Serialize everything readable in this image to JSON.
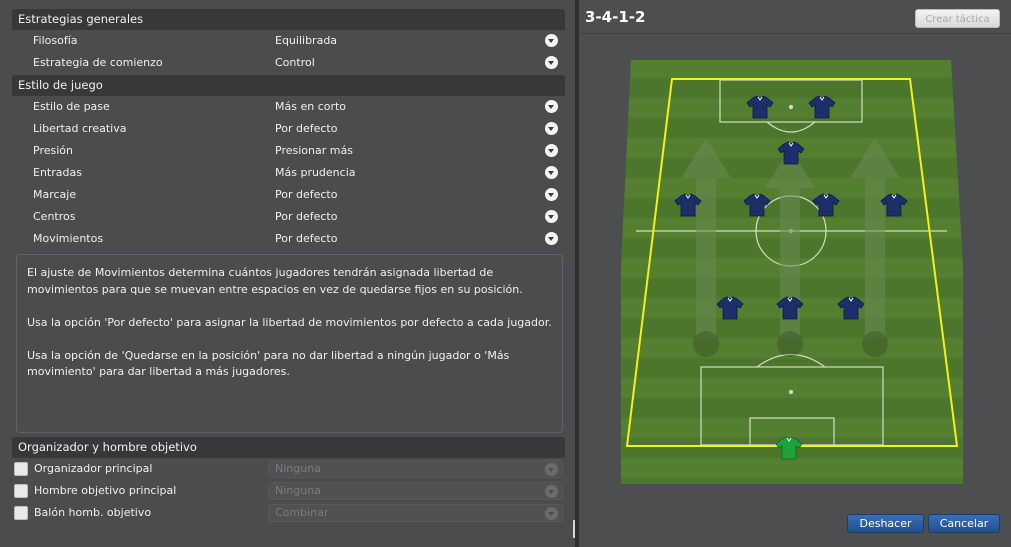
{
  "strategy": {
    "header": "Estrategias generales",
    "rows": [
      {
        "label": "Filosofía",
        "value": "Equilibrada"
      },
      {
        "label": "Estrategia de comienzo",
        "value": "Control"
      }
    ]
  },
  "style": {
    "header": "Estilo de juego",
    "rows": [
      {
        "label": "Estilo de pase",
        "value": "Más en corto"
      },
      {
        "label": "Libertad creativa",
        "value": "Por defecto"
      },
      {
        "label": "Presión",
        "value": "Presionar más"
      },
      {
        "label": "Entradas",
        "value": "Más prudencia"
      },
      {
        "label": "Marcaje",
        "value": "Por defecto"
      },
      {
        "label": "Centros",
        "value": "Por defecto"
      },
      {
        "label": "Movimientos",
        "value": "Por defecto"
      }
    ]
  },
  "info": {
    "p1": "El ajuste de Movimientos determina cuántos jugadores tendrán asignada libertad de\nmovimientos para que se muevan entre espacios en vez de quedarse fijos en su posición.",
    "p2": "Usa la opción 'Por defecto' para asignar la libertad de movimientos por defecto a cada jugador.",
    "p3": "Usa la opción de 'Quedarse en la posición' para no dar libertad a ningún jugador o 'Más\nmovimiento' para dar libertad a más jugadores."
  },
  "organizer": {
    "header": "Organizador y hombre objetivo",
    "rows": [
      {
        "label": "Organizador principal",
        "value": "Ninguna"
      },
      {
        "label": "Hombre objetivo principal",
        "value": "Ninguna"
      },
      {
        "label": "Balón homb. objetivo",
        "value": "Combinar"
      }
    ]
  },
  "tactic": {
    "formation": "3-4-1-2",
    "create_space": "Crear táctica",
    "undo": "Deshacer",
    "cancel": "Cancelar"
  },
  "colors": {
    "pitch_green": "#4f7a2c",
    "outline_yellow": "#f5f019",
    "shirt_blue": "#1c2f6b",
    "keeper_green": "#1fa23c",
    "button_blue": "#2b5ea1"
  },
  "icons": [
    "chevron-down-icon",
    "checkbox-icon",
    "player-shirt-icon",
    "football-icon",
    "arrow-up-icon"
  ]
}
